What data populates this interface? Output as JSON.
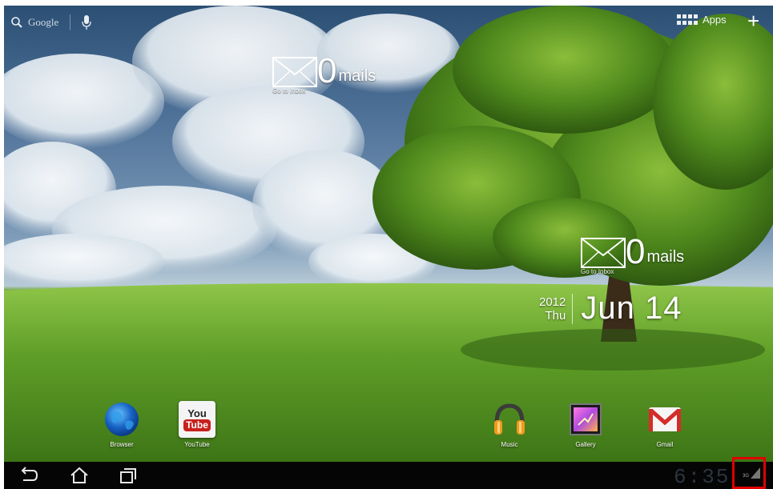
{
  "search": {
    "label": "Google"
  },
  "apps_button": {
    "label": "Apps"
  },
  "add_button": {
    "label": "+"
  },
  "mail_widgets": [
    {
      "count": "0",
      "unit": "mails",
      "action": "Go to Inbox"
    },
    {
      "count": "0",
      "unit": "mails",
      "action": "Go to Inbox"
    }
  ],
  "date": {
    "year": "2012",
    "weekday": "Thu",
    "month_day": "Jun 14"
  },
  "dock": [
    {
      "label": "Browser"
    },
    {
      "label": "YouTube",
      "icon_top": "You",
      "icon_bottom": "Tube"
    },
    {
      "label": "Music"
    },
    {
      "label": "Gallery"
    },
    {
      "label": "Gmail"
    }
  ],
  "status": {
    "time": "6:35",
    "signal_text": "3G"
  },
  "colors": {
    "highlight": "#e00000",
    "navbar": "#050505",
    "clock": "#2b3440"
  }
}
